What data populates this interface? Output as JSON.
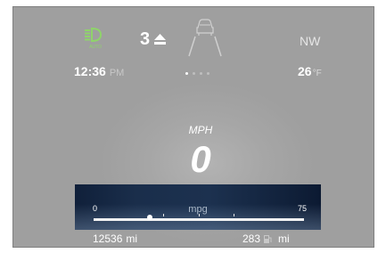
{
  "status": {
    "headlight_label": "AUTO",
    "gear": "3",
    "compass": "NW"
  },
  "info": {
    "time": "12:36",
    "ampm": "PM",
    "temperature": "26",
    "temperature_unit": "°F",
    "pages_total": 4,
    "page_active": 1
  },
  "speed": {
    "unit": "MPH",
    "value": "0"
  },
  "mpg_gauge": {
    "label": "mpg",
    "min": "0",
    "max": "75",
    "current": 20
  },
  "trip": {
    "odometer": "12536",
    "odometer_unit": "mi",
    "range": "283",
    "range_unit": "mi"
  },
  "colors": {
    "headlight_green": "#8fd46a",
    "panel_gray": "#a6a6a6",
    "mpg_panel": "#1a2e4b"
  }
}
